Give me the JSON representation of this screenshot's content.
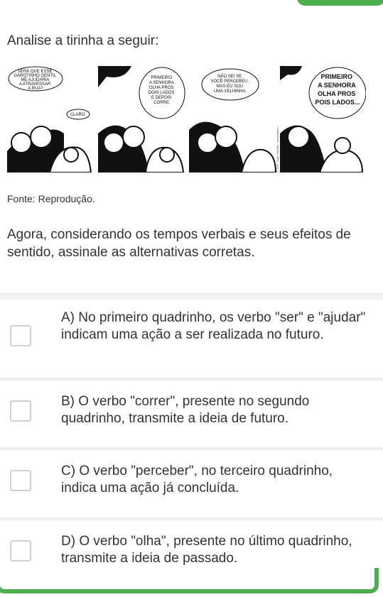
{
  "question": {
    "title": "Analise a tirinha a seguir:",
    "source": "Fonte: Reprodução.",
    "body": "Agora, considerando os tempos verbais e seus efeitos de sentido, assinale as alternativas corretas."
  },
  "comic": {
    "panels": [
      {
        "lines": [
          "SERÁ QUE ESSE",
          "GAROTINHO GENTIL",
          "ME AJUDARIA",
          "A ATRAVESSAR",
          "A RUA?"
        ],
        "reply": "CLARO."
      },
      {
        "lines": [
          "PRIMEIRO",
          "A SENHORA",
          "OLHA PROS",
          "DOIS LADOS",
          "E DEPOIS",
          "CORRE."
        ]
      },
      {
        "lines": [
          "NÃO SEI SE",
          "VOCÊ PERCEBEU,",
          "MAS EU SOU",
          "UMA VELHINHA."
        ]
      },
      {
        "lines": [
          "PRIMEIRO",
          "A SENHORA",
          "OLHA PROS",
          "POIS LADOS..."
        ]
      }
    ],
    "credit": "© 2011 Tiago Valadão - armandinho"
  },
  "options": [
    {
      "letter": "A)",
      "text": "A) No primeiro quadrinho, os verbo \"ser\" e \"ajudar\" indicam uma ação a ser realizada no futuro."
    },
    {
      "letter": "B)",
      "text": "B) O verbo \"correr\", presente no segundo quadrinho, transmite a ideia de futuro."
    },
    {
      "letter": "C)",
      "text": "C) O verbo \"perceber\", no terceiro quadrinho, indica uma ação já concluída."
    },
    {
      "letter": "D)",
      "text": "D) O verbo \"olha\", presente no último quadrinho, transmite a ideia de passado."
    }
  ],
  "colors": {
    "accent": "#4cae4c",
    "text": "#333333",
    "checkbox_border": "#cfcfcf"
  }
}
